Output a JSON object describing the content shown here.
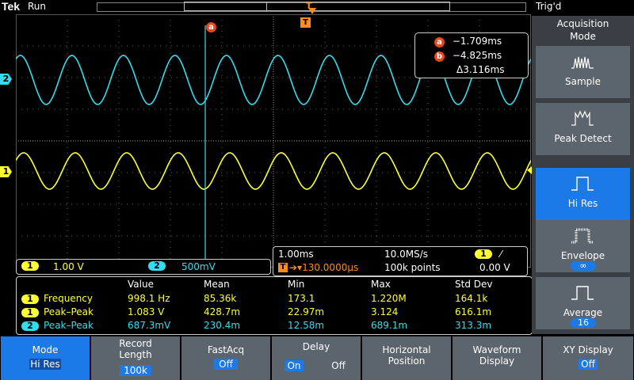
{
  "status": {
    "brand": "Tek",
    "run_state": "Run",
    "trigger_state": "Trig'd"
  },
  "markers": {
    "cursor_a": "a",
    "cursor_b": "b",
    "trigger": "T",
    "ch1": "1",
    "ch2": "2"
  },
  "cursor_readout": {
    "a_label": "a",
    "a_value": "−1.709ms",
    "b_label": "b",
    "b_value": "−4.825ms",
    "delta": "Δ3.116ms"
  },
  "channels": {
    "ch1": {
      "label": "1",
      "scale": "1.00 V",
      "color": "#ffff33"
    },
    "ch2": {
      "label": "2",
      "scale": "500mV",
      "color": "#33ddee"
    }
  },
  "timebase": {
    "horiz_scale": "1.00ms",
    "sample_rate": "10.0MS/s",
    "trig_channel": "1",
    "trig_slope": "⁄",
    "delay_label": "T",
    "delay": "➔▾130.0000µs",
    "record_points": "100k points",
    "trig_level": "0.00 V"
  },
  "measurements": {
    "headers": [
      "Value",
      "Mean",
      "Min",
      "Max",
      "Std Dev"
    ],
    "rows": [
      {
        "ch": "1",
        "name": "Frequency",
        "value": "998.1 Hz",
        "mean": "85.36k",
        "min": "173.1",
        "max": "1.220M",
        "std": "164.1k"
      },
      {
        "ch": "1",
        "name": "Peak–Peak",
        "value": "1.083 V",
        "mean": "428.7m",
        "min": "22.97m",
        "max": "3.124",
        "std": "616.1m"
      },
      {
        "ch": "2",
        "name": "Peak–Peak",
        "value": "687.3mV",
        "mean": "230.4m",
        "min": "12.58m",
        "max": "689.1m",
        "std": "313.3m"
      }
    ]
  },
  "side_menu": {
    "title": "Acquisition Mode",
    "items": [
      {
        "label": "Sample"
      },
      {
        "label": "Peak Detect"
      },
      {
        "label": "Hi Res"
      },
      {
        "label": "Envelope",
        "sub": "∞"
      },
      {
        "label": "Average",
        "sub": "16"
      }
    ]
  },
  "bottom_menu": [
    {
      "title": "Mode",
      "value": "Hi Res"
    },
    {
      "title": "Record Length",
      "value": "100k"
    },
    {
      "title": "FastAcq",
      "value": "Off"
    },
    {
      "title": "Delay",
      "on": "On",
      "off": "Off"
    },
    {
      "title": "Horizontal Position"
    },
    {
      "title": "Waveform Display"
    },
    {
      "title": "XY Display",
      "value": "Off"
    }
  ],
  "waveforms": {
    "ch1_cycles": 10,
    "ch2_cycles": 10
  }
}
